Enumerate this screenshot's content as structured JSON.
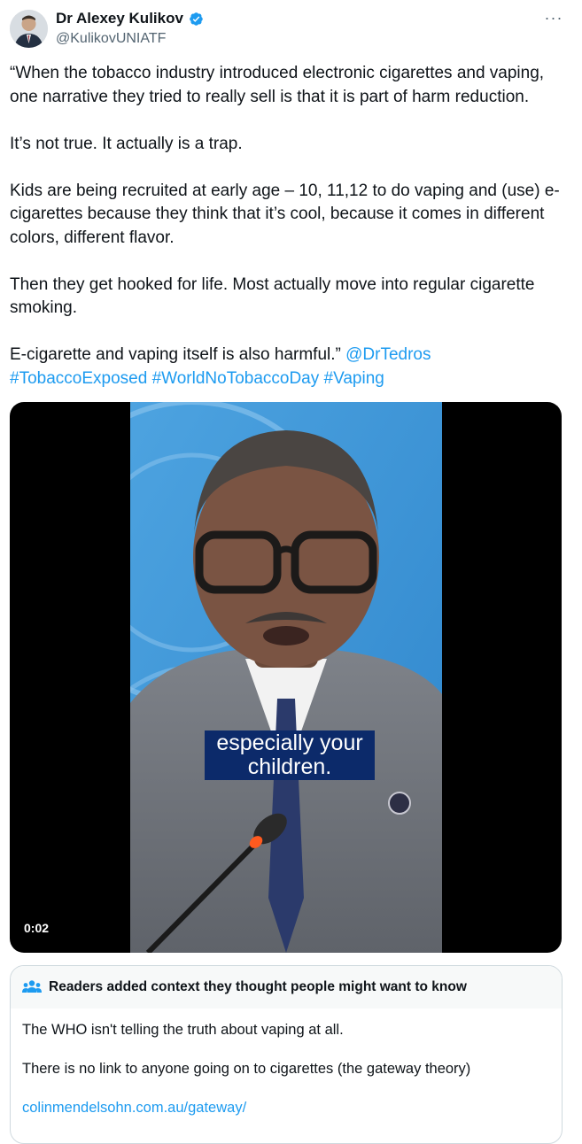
{
  "author": {
    "name": "Dr Alexey Kulikov",
    "handle": "@KulikovUNIATF"
  },
  "more_menu": {
    "icon": "more-horizontal-icon",
    "label": "···"
  },
  "tweet": {
    "paragraphs": [
      "“When the tobacco industry introduced electronic cigarettes and vaping, one narrative they tried to really sell is that it is part of harm reduction.",
      "It’s not true. It actually is a trap.",
      "Kids are being recruited at early age – 10, 11,12 to do vaping and (use) e-cigarettes because they think that it’s cool, because it comes in different colors, different flavor.",
      "Then they get hooked for life. Most actually move into regular cigarette smoking."
    ],
    "last_text": "E-cigarette and vaping itself is also harmful.” ",
    "mention": "@DrTedros",
    "hashtags": [
      "#TobaccoExposed",
      "#WorldNoTobaccoDay",
      "#Vaping"
    ]
  },
  "media": {
    "caption_line1": "especially your",
    "caption_line2": "children.",
    "timestamp": "0:02"
  },
  "community_note": {
    "icon": "people-icon",
    "title": "Readers added context they thought people might want to know",
    "lines": [
      "The WHO isn't telling the truth about vaping at all.",
      "There is no link to anyone going on to cigarettes (the gateway theory)"
    ],
    "link": "colinmendelsohn.com.au/gateway/"
  },
  "colors": {
    "link": "#1d9bf0",
    "verified": "#1d9bf0",
    "caption_bg": "#0c2a6a",
    "note_header_bg": "#f7f9f9"
  }
}
